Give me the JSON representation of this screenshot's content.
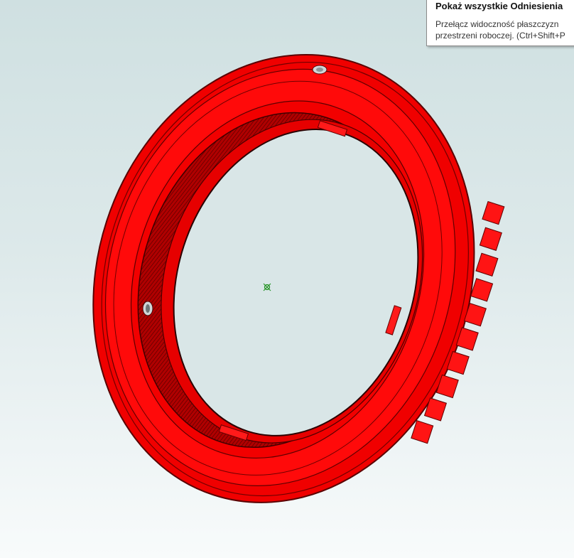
{
  "tooltip": {
    "title": "Pokaż wszystkie Odniesienia",
    "line1": "Przełącz widoczność płaszczyzn",
    "line2": "przestrzeni roboczej. (Ctrl+Shift+P"
  },
  "model": {
    "icon": "red-lens-adapter-ring",
    "color": "#ff0000",
    "origin_icon": "origin-marker-icon"
  }
}
